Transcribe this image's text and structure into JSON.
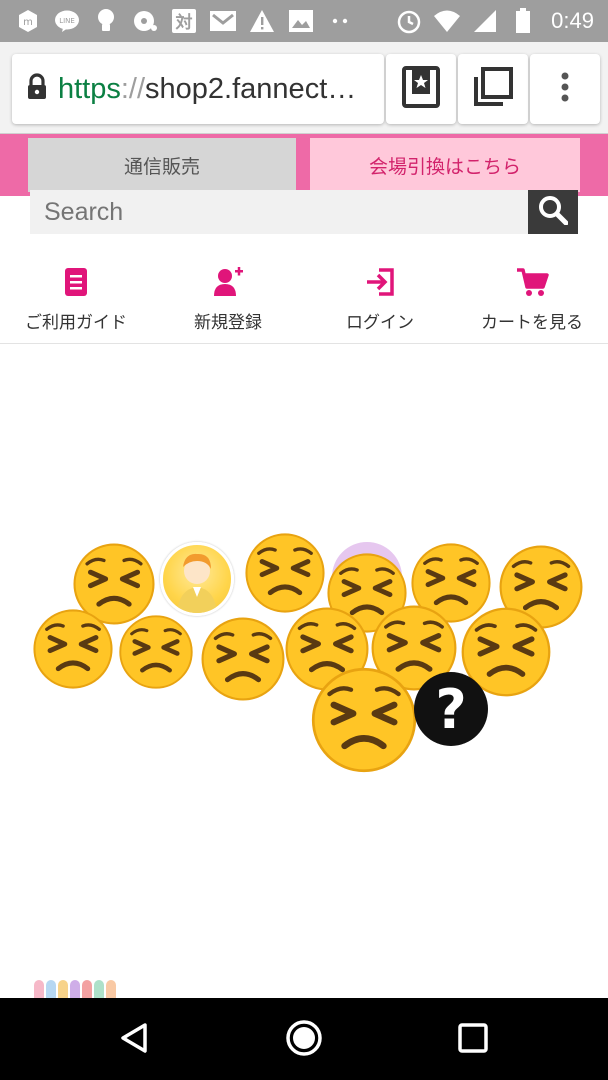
{
  "status_bar": {
    "time": "0:49",
    "left_icons": [
      "app-icon",
      "line-icon",
      "bulb-icon",
      "record-icon",
      "kanji-app-icon",
      "mail-icon",
      "warning-icon",
      "image-icon",
      "more-dots-icon"
    ],
    "right_icons": [
      "alarm-icon",
      "wifi-icon",
      "signal-icon",
      "battery-icon"
    ]
  },
  "browser": {
    "url_scheme": "https",
    "url_sep": "://",
    "url_host": "shop2.fannect…"
  },
  "banner": {
    "mail_order": "通信販売",
    "venue_pickup": "会場引換はこちら"
  },
  "search": {
    "placeholder": "Search"
  },
  "nav": {
    "guide": "ご利用ガイド",
    "register": "新規登録",
    "login": "ログイン",
    "cart": "カートを見る"
  },
  "colors": {
    "accent": "#e0157a",
    "banner": "#ee6aa7",
    "emoji": "#ffc526"
  }
}
